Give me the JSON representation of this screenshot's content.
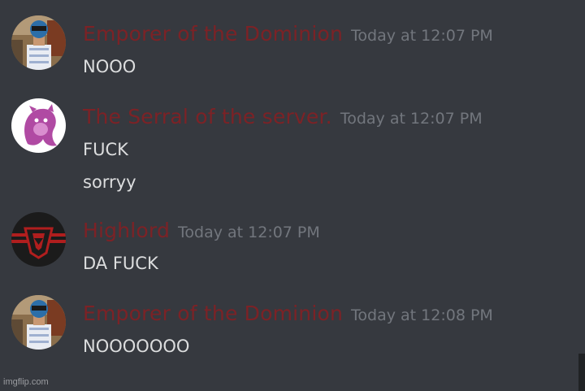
{
  "colors": {
    "background": "#36393f",
    "username": "#7c2226",
    "timestamp": "#72767d",
    "message_text": "#dcddde"
  },
  "messages": [
    {
      "avatar_icon": "person-photo-avatar-icon",
      "username": "Emporer of the Dominion",
      "timestamp": "Today at 12:07 PM",
      "lines": [
        "NOOO"
      ]
    },
    {
      "avatar_icon": "purple-creature-avatar-icon",
      "username": "The Serral of the server.",
      "timestamp": "Today at 12:07 PM",
      "lines": [
        "FUCK",
        "sorryy"
      ]
    },
    {
      "avatar_icon": "red-eagle-emblem-avatar-icon",
      "username": "Highlord",
      "timestamp": "Today at 12:07 PM",
      "lines": [
        "DA FUCK"
      ]
    },
    {
      "avatar_icon": "person-photo-avatar-icon",
      "username": "Emporer of the Dominion",
      "timestamp": "Today at 12:08 PM",
      "lines": [
        "NOOOOOOO"
      ]
    }
  ],
  "watermark": "imgflip.com"
}
